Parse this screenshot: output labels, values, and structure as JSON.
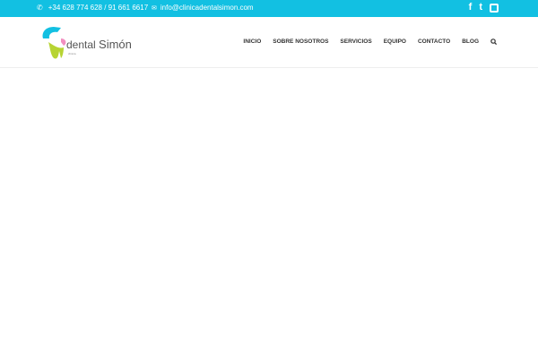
{
  "topbar": {
    "phone": "+34 628 774 628 / 91 661 6617",
    "email": "info@clinicadentalsimon.com",
    "colors": {
      "accent": "#12c0e2"
    }
  },
  "logo": {
    "text_main": "dental",
    "text_name": "Simón",
    "text_sub": "clínica"
  },
  "nav": {
    "items": [
      "INICIO",
      "SOBRE NOSOTROS",
      "SERVICIOS",
      "EQUIPO",
      "CONTACTO",
      "BLOG"
    ]
  }
}
